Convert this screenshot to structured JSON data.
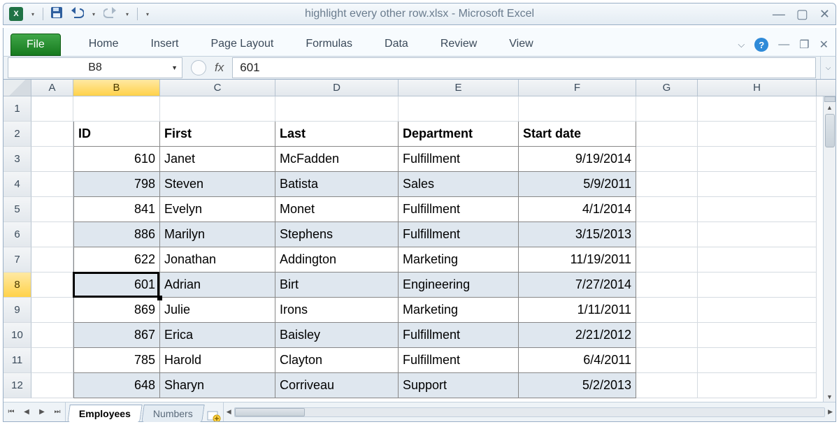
{
  "window": {
    "title_full": "highlight every other row.xlsx  -  Microsoft Excel",
    "app_name": "Microsoft Excel",
    "file_name": "highlight every other row.xlsx"
  },
  "ribbon": {
    "file_tab": "File",
    "tabs": [
      "Home",
      "Insert",
      "Page Layout",
      "Formulas",
      "Data",
      "Review",
      "View"
    ]
  },
  "name_box": "B8",
  "fx_label": "fx",
  "formula_bar": "601",
  "columns": [
    "A",
    "B",
    "C",
    "D",
    "E",
    "F",
    "G",
    "H"
  ],
  "row_numbers": [
    1,
    2,
    3,
    4,
    5,
    6,
    7,
    8,
    9,
    10,
    11,
    12
  ],
  "selected_cell": "B8",
  "selected_row": 8,
  "selected_col": "B",
  "table": {
    "headers": [
      "ID",
      "First",
      "Last",
      "Department",
      "Start date"
    ],
    "rows": [
      {
        "id": "610",
        "first": "Janet",
        "last": "McFadden",
        "dept": "Fulfillment",
        "date": "9/19/2014"
      },
      {
        "id": "798",
        "first": "Steven",
        "last": "Batista",
        "dept": "Sales",
        "date": "5/9/2011"
      },
      {
        "id": "841",
        "first": "Evelyn",
        "last": "Monet",
        "dept": "Fulfillment",
        "date": "4/1/2014"
      },
      {
        "id": "886",
        "first": "Marilyn",
        "last": "Stephens",
        "dept": "Fulfillment",
        "date": "3/15/2013"
      },
      {
        "id": "622",
        "first": "Jonathan",
        "last": "Addington",
        "dept": "Marketing",
        "date": "11/19/2011"
      },
      {
        "id": "601",
        "first": "Adrian",
        "last": "Birt",
        "dept": "Engineering",
        "date": "7/27/2014"
      },
      {
        "id": "869",
        "first": "Julie",
        "last": "Irons",
        "dept": "Marketing",
        "date": "1/11/2011"
      },
      {
        "id": "867",
        "first": "Erica",
        "last": "Baisley",
        "dept": "Fulfillment",
        "date": "2/21/2012"
      },
      {
        "id": "785",
        "first": "Harold",
        "last": "Clayton",
        "dept": "Fulfillment",
        "date": "6/4/2011"
      },
      {
        "id": "648",
        "first": "Sharyn",
        "last": "Corriveau",
        "dept": "Support",
        "date": "5/2/2013"
      }
    ]
  },
  "sheets": {
    "active": "Employees",
    "others": [
      "Numbers"
    ]
  }
}
